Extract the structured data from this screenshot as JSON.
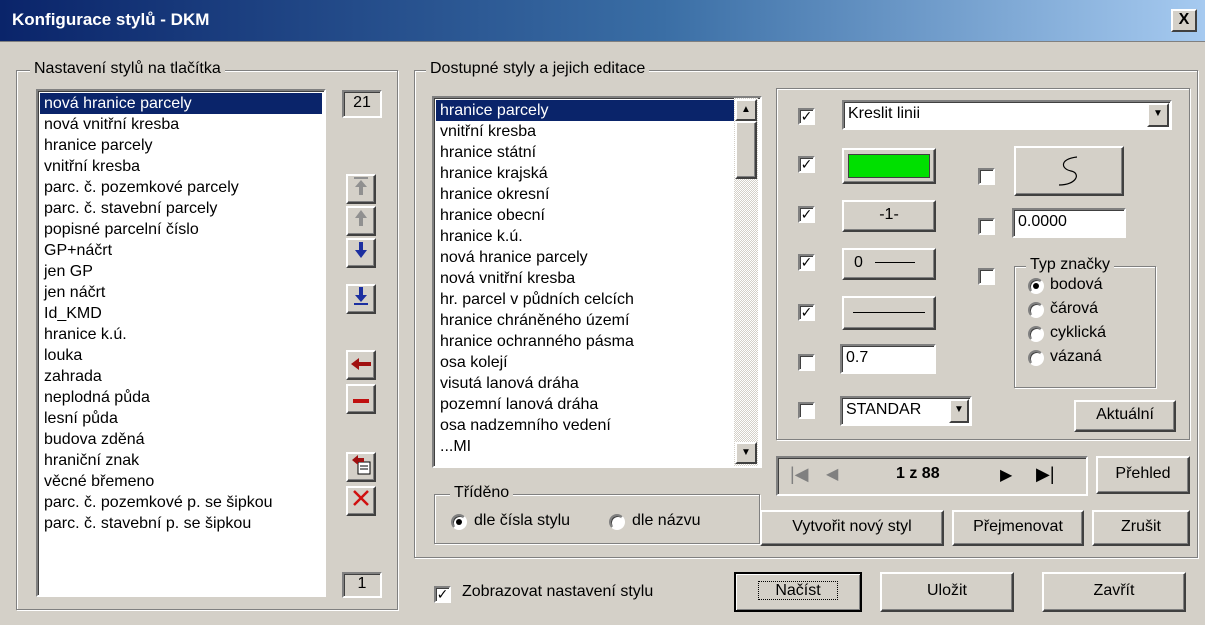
{
  "window": {
    "title": "Konfigurace stylů - DKM",
    "close_label": "X"
  },
  "left_group": {
    "legend": "Nastavení stylů na tlačítka",
    "count_top": "21",
    "count_bottom": "1",
    "items": [
      "nová hranice parcely",
      "nová vnitřní kresba",
      "hranice parcely",
      "vnitřní kresba",
      "parc. č. pozemkové parcely",
      "parc. č. stavební parcely",
      "popisné parcelní číslo",
      "GP+náčrt",
      "jen GP",
      "jen náčrt",
      "Id_KMD",
      "hranice k.ú.",
      "louka",
      "zahrada",
      "neplodná půda",
      "lesní půda",
      "budova zděná",
      "hraniční znak",
      "věcné břemeno",
      "parc. č. pozemkové p. se šipkou",
      "parc. č. stavební p. se šipkou"
    ],
    "selected_index": 0,
    "side_buttons": {
      "move_top_icon": "move-to-top-icon",
      "move_up_icon": "move-up-icon",
      "move_down_icon": "move-down-icon",
      "move_bottom_icon": "move-to-bottom-icon",
      "add_icon": "add-arrow-icon",
      "remove_icon": "remove-minus-icon",
      "import_icon": "import-icon",
      "delete_icon": "delete-x-icon"
    }
  },
  "styles_group": {
    "legend": "Dostupné styly a jejich editace",
    "items": [
      "hranice parcely",
      "vnitřní kresba",
      "hranice státní",
      "hranice krajská",
      "hranice okresní",
      "hranice obecní",
      "hranice k.ú.",
      "nová hranice parcely",
      "nová vnitřní kresba",
      "hr. parcel v půdních celcích",
      "hranice chráněného území",
      "hranice ochranného pásma",
      "osa kolejí",
      "visutá lanová dráha",
      "pozemní lanová dráha",
      "osa nadzemního vedení",
      "...MI"
    ],
    "selected_index": 0,
    "sort": {
      "legend": "Tříděno",
      "option_number": "dle čísla stylu",
      "option_name": "dle názvu",
      "selected": "number"
    }
  },
  "editor": {
    "draw_mode": "Kreslit linii",
    "draw_mode_checked": true,
    "color": "#00e000",
    "color_checked": true,
    "line_type_label": "-1-",
    "line_type_checked": true,
    "weight_label": "0",
    "weight_checked": true,
    "style_checked": true,
    "scale_value": "0.7",
    "scale_checked": false,
    "font_value": "STANDAR",
    "font_checked": false,
    "curve_checked": false,
    "angle_value": "0.0000",
    "angle_checked": false,
    "mark_checked": false,
    "mark_type": {
      "legend": "Typ značky",
      "options": [
        "bodová",
        "čárová",
        "cyklická",
        "vázaná"
      ],
      "selected": "bodová"
    },
    "current_button": "Aktuální"
  },
  "navigator": {
    "position": "1 z 88",
    "overview_button": "Přehled",
    "first_icon": "first-record-icon",
    "prev_icon": "previous-record-icon",
    "next_icon": "next-record-icon",
    "last_icon": "last-record-icon"
  },
  "actions": {
    "new_style": "Vytvořit nový styl",
    "rename": "Přejmenovat",
    "cancel": "Zrušit"
  },
  "footer": {
    "show_settings_label": "Zobrazovat nastavení stylu",
    "show_settings_checked": true,
    "load": "Načíst",
    "save": "Uložit",
    "close": "Zavřít"
  }
}
